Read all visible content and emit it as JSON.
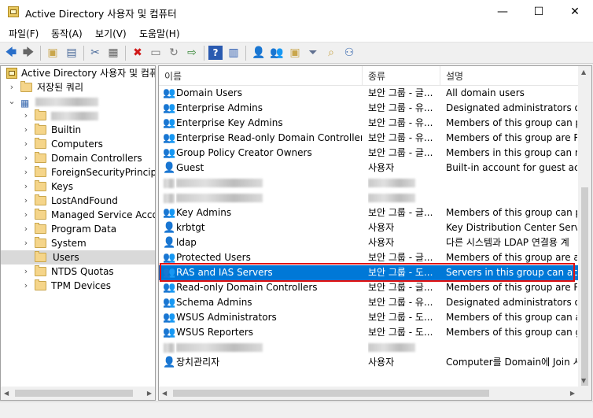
{
  "window": {
    "title": "Active Directory 사용자 및 컴퓨터",
    "minimize": "—",
    "maximize": "☐",
    "close": "✕"
  },
  "menu": [
    "파일(F)",
    "동작(A)",
    "보기(V)",
    "도움말(H)"
  ],
  "tree": {
    "root_label": "Active Directory 사용자 및 컴퓨터",
    "saved_queries": "저장된 쿼리",
    "containers": [
      "Builtin",
      "Computers",
      "Domain Controllers",
      "ForeignSecurityPrincipal",
      "Keys",
      "LostAndFound",
      "Managed Service Accou",
      "Program Data",
      "System",
      "Users",
      "NTDS Quotas",
      "TPM Devices"
    ],
    "selected": "Users"
  },
  "list": {
    "columns": [
      "이름",
      "종류",
      "설명"
    ],
    "rows": [
      {
        "name": "Domain Users",
        "type": "보안 그룹 - 글...",
        "desc": "All domain users",
        "icon": "group"
      },
      {
        "name": "Enterprise Admins",
        "type": "보안 그룹 - 유...",
        "desc": "Designated administrators of th",
        "icon": "group"
      },
      {
        "name": "Enterprise Key Admins",
        "type": "보안 그룹 - 유...",
        "desc": "Members of this group can per",
        "icon": "group"
      },
      {
        "name": "Enterprise Read-only Domain Controllers",
        "type": "보안 그룹 - 유...",
        "desc": "Members of this group are Rea",
        "icon": "group"
      },
      {
        "name": "Group Policy Creator Owners",
        "type": "보안 그룹 - 글...",
        "desc": "Members in this group can mo",
        "icon": "group"
      },
      {
        "name": "Guest",
        "type": "사용자",
        "desc": "Built-in account for guest acces",
        "icon": "user-disabled"
      },
      {
        "name": "",
        "type": "",
        "desc": "",
        "icon": "blurred"
      },
      {
        "name": "",
        "type": "",
        "desc": "",
        "icon": "blurred"
      },
      {
        "name": "Key Admins",
        "type": "보안 그룹 - 글...",
        "desc": "Members of this group can per",
        "icon": "group"
      },
      {
        "name": "krbtgt",
        "type": "사용자",
        "desc": "Key Distribution Center Service",
        "icon": "user-disabled"
      },
      {
        "name": "ldap",
        "type": "사용자",
        "desc": "다른 시스템과 LDAP 연결용 계",
        "icon": "user"
      },
      {
        "name": "Protected Users",
        "type": "보안 그룹 - 글...",
        "desc": "Members of this group are affo",
        "icon": "group"
      },
      {
        "name": "RAS and IAS Servers",
        "type": "보안 그룹 - 도...",
        "desc": "Servers in this group can acces",
        "icon": "group"
      },
      {
        "name": "Read-only Domain Controllers",
        "type": "보안 그룹 - 글...",
        "desc": "Members of this group are Rea",
        "icon": "group"
      },
      {
        "name": "Schema Admins",
        "type": "보안 그룹 - 유...",
        "desc": "Designated administrators of th",
        "icon": "group"
      },
      {
        "name": "WSUS Administrators",
        "type": "보안 그룹 - 도...",
        "desc": "Members of this group can adr",
        "icon": "group"
      },
      {
        "name": "WSUS Reporters",
        "type": "보안 그룹 - 도...",
        "desc": "Members of this group can ger",
        "icon": "group"
      },
      {
        "name": "",
        "type": "",
        "desc": "",
        "icon": "blurred"
      },
      {
        "name": "장치관리자",
        "type": "사용자",
        "desc": "Computer를 Domain에 Join 시",
        "icon": "user"
      }
    ],
    "selected_row": "RAS and IAS Servers"
  },
  "colors": {
    "selection": "#0078d7",
    "highlight_box": "#e01010"
  }
}
